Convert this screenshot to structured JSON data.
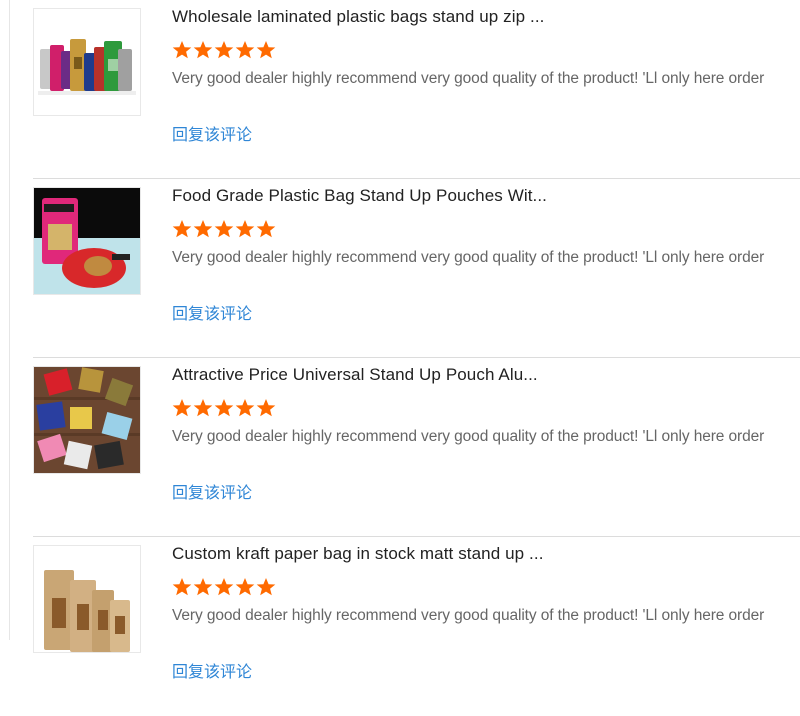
{
  "accent_color": "#ff6a00",
  "link_color": "#2f86d6",
  "reviews": [
    {
      "title": "Wholesale laminated plastic bags stand up zip ...",
      "rating": 5,
      "text": "Very good dealer highly recommend very good quality of the product!   'Ll only here order",
      "reply": "回复该评论",
      "image": "colorful-stand-up-pouches"
    },
    {
      "title": "Food Grade Plastic Bag Stand Up Pouches Wit...",
      "rating": 5,
      "text": "Very good dealer highly recommend very good quality of the product!   'Ll only here order",
      "reply": "回复该评论",
      "image": "pink-and-red-pouches"
    },
    {
      "title": "Attractive Price Universal Stand Up Pouch Alu...",
      "rating": 5,
      "text": "Very good dealer highly recommend very good quality of the product!   'Ll only here order",
      "reply": "回复该评论",
      "image": "multicolor-flat-pouches-on-wood"
    },
    {
      "title": "Custom kraft paper bag in stock matt stand up ...",
      "rating": 5,
      "text": "Very good dealer highly recommend very good quality of the product!   'Ll only here order",
      "reply": "回复该评论",
      "image": "kraft-paper-pouches"
    }
  ]
}
